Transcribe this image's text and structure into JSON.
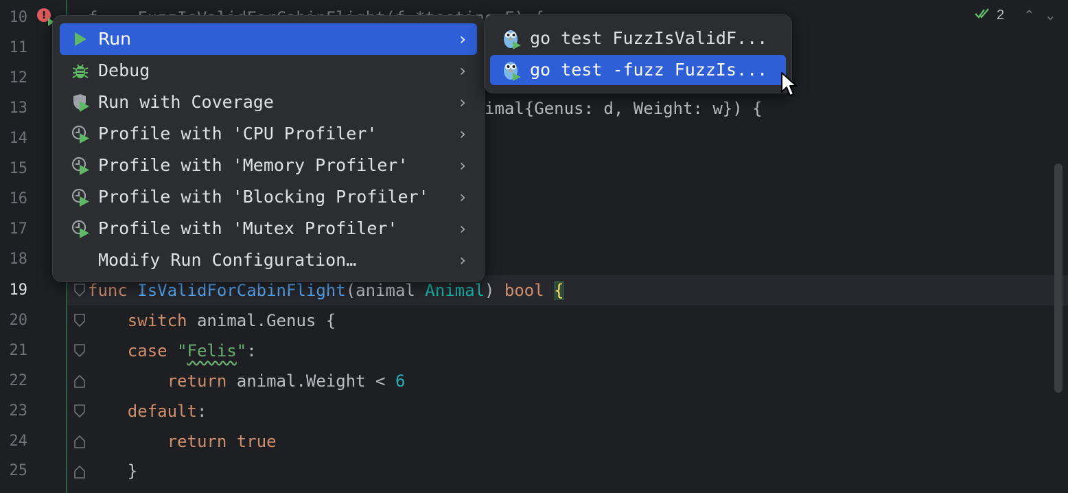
{
  "editor": {
    "line_numbers": [
      "10",
      "11",
      "12",
      "13",
      "14",
      "15",
      "16",
      "17",
      "18",
      "19",
      "20",
      "21",
      "22",
      "23",
      "24",
      "25"
    ],
    "active_line": "19",
    "visible_fragments": {
      "line10": "f    FuzzIsValidForCabinFlight(f *testing.F) {",
      "line13": "imal{Genus: d, Weight: w}) {"
    },
    "code": {
      "l19": {
        "kw": "func",
        "name": "IsValidForCabinFlight",
        "paren_open": "(",
        "param": "animal",
        "type": "Animal",
        "paren_close": ")",
        "ret": "bool",
        "brace": "{"
      },
      "l20": {
        "kw": "switch",
        "expr": "animal.Genus",
        "brace": "{"
      },
      "l21": {
        "kw": "case",
        "quote_open": "\"",
        "str": "Felis",
        "quote_close": "\"",
        "colon": ":"
      },
      "l22": {
        "kw": "return",
        "expr": "animal.Weight < ",
        "num": "6"
      },
      "l23": {
        "kw": "default",
        "colon": ":"
      },
      "l24": {
        "kw": "return",
        "val": "true"
      },
      "l25": {
        "brace": "}"
      }
    }
  },
  "inspection": {
    "count": "2",
    "icon": "double-check-icon"
  },
  "context_menu": {
    "items": [
      {
        "label": "Run",
        "icon": "run-icon"
      },
      {
        "label": "Debug",
        "icon": "debug-icon"
      },
      {
        "label": "Run with Coverage",
        "icon": "coverage-icon"
      },
      {
        "label": "Profile with 'CPU Profiler'",
        "icon": "profiler-icon"
      },
      {
        "label": "Profile with 'Memory Profiler'",
        "icon": "profiler-icon"
      },
      {
        "label": "Profile with 'Blocking Profiler'",
        "icon": "profiler-icon"
      },
      {
        "label": "Profile with 'Mutex Profiler'",
        "icon": "profiler-icon"
      },
      {
        "label": "Modify Run Configuration…",
        "icon": ""
      }
    ],
    "selected_index": 0,
    "submenu_arrow": "›"
  },
  "submenu": {
    "items": [
      {
        "label": "go test FuzzIsValidF...",
        "icon": "gopher-icon"
      },
      {
        "label": "go test -fuzz FuzzIs...",
        "icon": "gopher-icon"
      }
    ],
    "selected_index": 1
  },
  "colors": {
    "accent_selection": "#2e5fd6",
    "run_green": "#5fb865",
    "error_red": "#db5c5c"
  }
}
